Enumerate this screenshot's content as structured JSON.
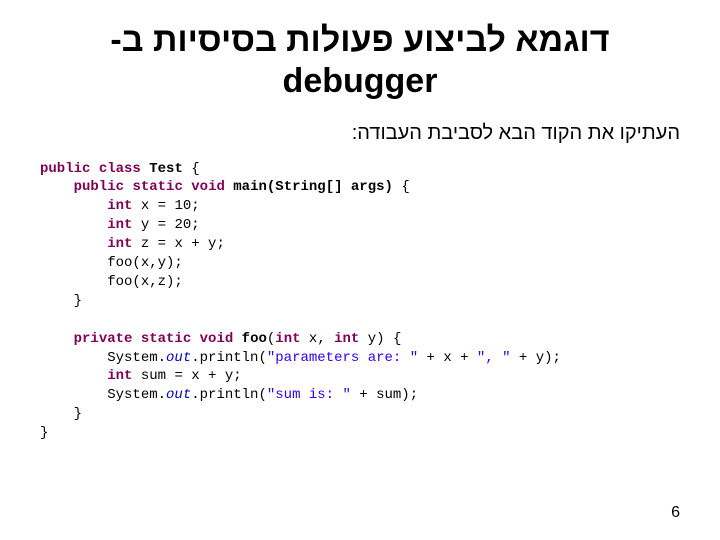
{
  "title": {
    "line1": "דוגמא לביצוע פעולות בסיסיות ב-",
    "line2": "debugger"
  },
  "subtitle": "העתיקו את הקוד הבא לסביבת העבודה:",
  "code": {
    "kw_public": "public",
    "kw_class": "class",
    "kw_static": "static",
    "kw_void": "void",
    "kw_int": "int",
    "kw_private": "private",
    "cls_test": "Test",
    "mtd_main": "main(String[] args)",
    "mtd_foo_decl": "foo",
    "args_foo": "int",
    "x_decl": " x = 10;",
    "y_decl": " y = 20;",
    "z_decl": " z = x + y;",
    "call_foo1": "        foo(x,y);",
    "call_foo2": "        foo(x,z);",
    "brace_close": "    }",
    "brace_close_outer": "}",
    "foo_param1": " x, ",
    "foo_param2": " y) {",
    "sysout": "System.",
    "out": "out",
    "println": ".println(",
    "str_params": "\"parameters are: \"",
    "plus_x": " + x + ",
    "str_comma": "\", \"",
    "plus_y": " + y);",
    "sum_decl": " sum = x + y;",
    "str_sum": "\"sum is: \"",
    "plus_sum": " + sum);"
  },
  "page_number": "6"
}
